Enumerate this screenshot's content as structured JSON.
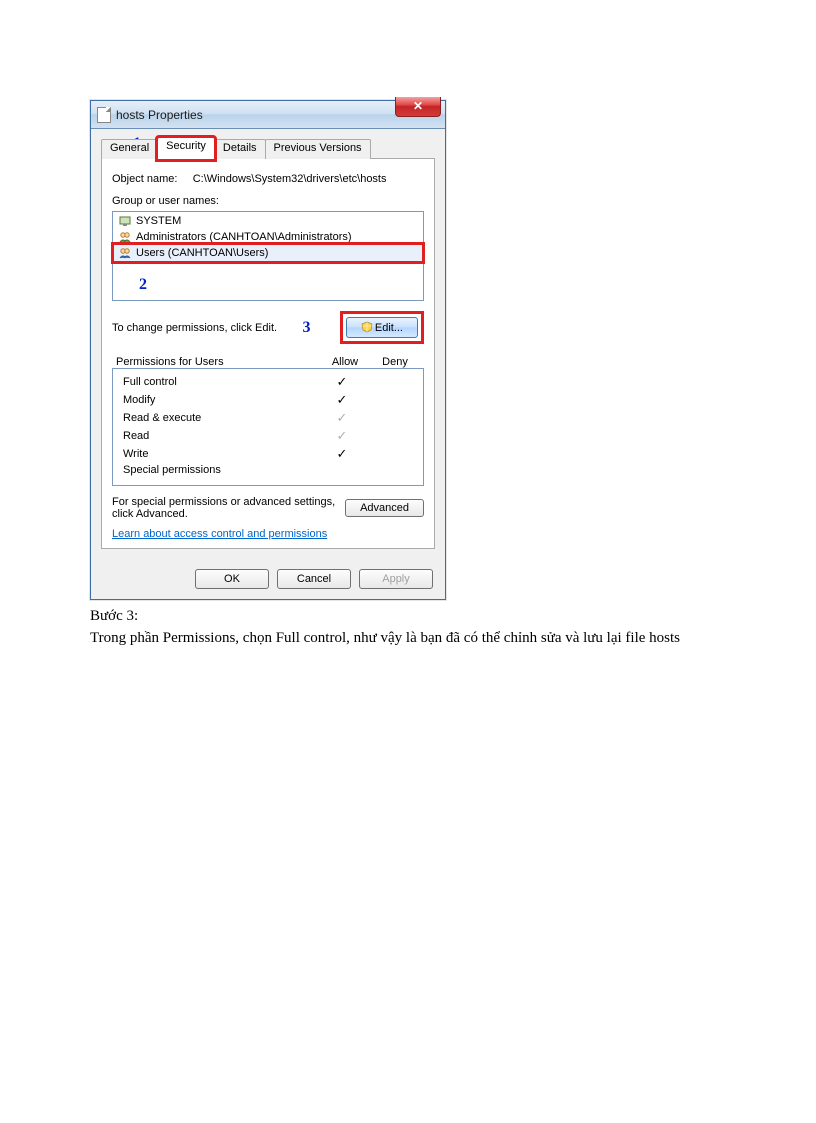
{
  "window": {
    "title": "hosts Properties",
    "close_glyph": "✕"
  },
  "tabs": {
    "general": "General",
    "security": "Security",
    "details": "Details",
    "previous": "Previous Versions"
  },
  "object_name_label": "Object name:",
  "object_name_value": "C:\\Windows\\System32\\drivers\\etc\\hosts",
  "group_label": "Group or user names:",
  "list": {
    "system": "SYSTEM",
    "admins": "Administrators (CANHTOAN\\Administrators)",
    "users": "Users (CANHTOAN\\Users)"
  },
  "annotations": {
    "a1": "1",
    "a2": "2",
    "a3": "3"
  },
  "change_text": "To change permissions, click Edit.",
  "edit_btn": "Edit...",
  "perm_header": {
    "col1": "Permissions for Users",
    "col2": "Allow",
    "col3": "Deny"
  },
  "perms": [
    {
      "name": "Full control",
      "allow": "dark",
      "deny": ""
    },
    {
      "name": "Modify",
      "allow": "dark",
      "deny": ""
    },
    {
      "name": "Read & execute",
      "allow": "grey",
      "deny": ""
    },
    {
      "name": "Read",
      "allow": "grey",
      "deny": ""
    },
    {
      "name": "Write",
      "allow": "dark",
      "deny": ""
    },
    {
      "name": "Special permissions",
      "allow": "",
      "deny": ""
    }
  ],
  "advanced_text": "For special permissions or advanced settings, click Advanced.",
  "advanced_btn": "Advanced",
  "link_text": "Learn about access control and permissions",
  "buttons": {
    "ok": "OK",
    "cancel": "Cancel",
    "apply": "Apply"
  },
  "caption": {
    "line1": "Bước 3:",
    "line2": "Trong phần Permissions,  chọn Full control, như vậy là bạn đã có thể chỉnh sửa và lưu lại file hosts"
  }
}
